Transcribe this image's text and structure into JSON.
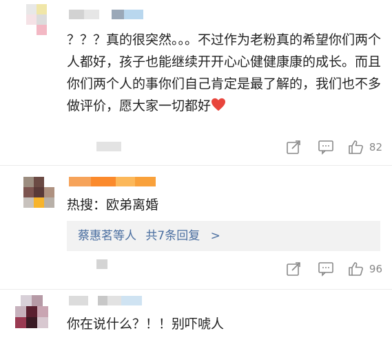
{
  "comments": [
    {
      "text": "？？？真的很突然。。。不过作为老粉真的希望你们两个人都好，孩子也能继续开开心心健健康康的成长。而且你们两个人的事你们自己肯定是最了解的，我们也不多做评价，愿大家一切都好",
      "likes": "82"
    },
    {
      "text": "热搜：欧弟离婚",
      "replies": {
        "names": "蔡惠茗等人",
        "count_label": "共7条回复",
        "arrow": ">"
      },
      "likes": "96"
    },
    {
      "text": "你在说什么？！！别吓唬人"
    }
  ],
  "colors": {
    "link": "#4a6ea0",
    "icon": "#888888",
    "heart": "#e8453c",
    "reply_bg": "#f2f2f2"
  },
  "icons": [
    "share-icon",
    "comment-icon",
    "like-icon",
    "heart-emoji"
  ]
}
